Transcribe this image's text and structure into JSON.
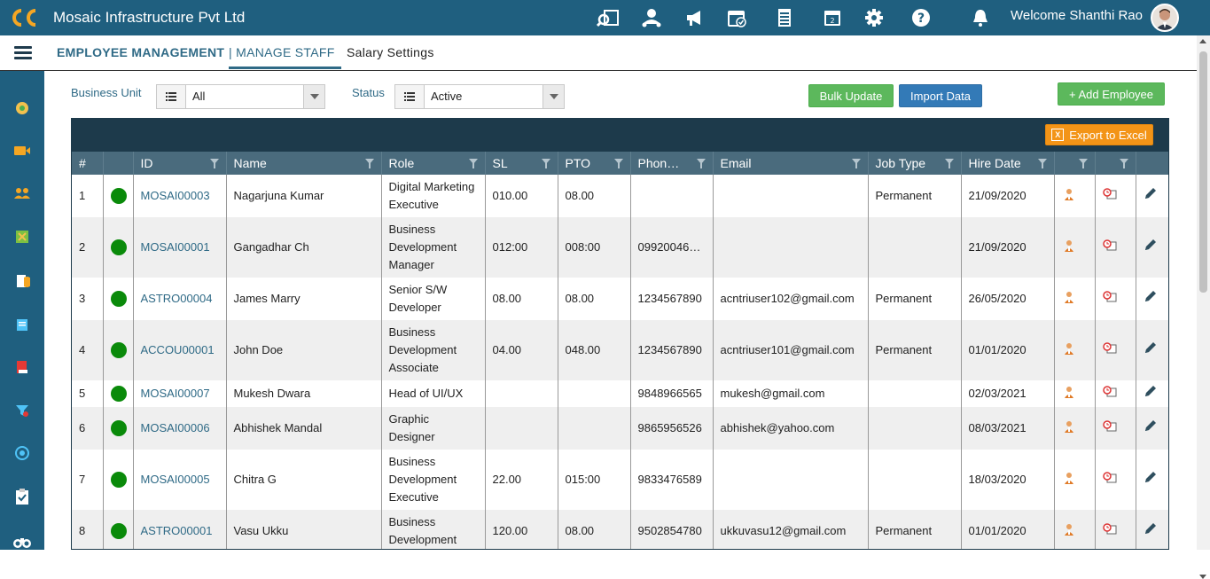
{
  "app": {
    "title": "Mosaic Infrastructure Pvt Ltd",
    "welcome": "Welcome Shanthi Rao"
  },
  "top_icons": [
    "search-report-icon",
    "team-icon",
    "announcement-icon",
    "calendar-check-icon",
    "document-list-icon",
    "calendar-day-icon",
    "gear-icon",
    "help-icon",
    "bell-icon"
  ],
  "nav": {
    "title": "EMPLOYEE MANAGEMENT",
    "active_tab": "| MANAGE STAFF",
    "tab": "Salary Settings"
  },
  "sidebar": [
    "dashboard-icon",
    "video-icon",
    "people-icon",
    "puzzle-icon",
    "pie-chart-icon",
    "notes-icon",
    "book-icon",
    "filter-icon",
    "target-icon",
    "clipboard-icon",
    "binoculars-icon"
  ],
  "filters": {
    "business_unit_label": "Business Unit",
    "business_unit_value": "All",
    "status_label": "Status",
    "status_value": "Active"
  },
  "actions": {
    "bulk_update": "Bulk Update",
    "import_data": "Import Data",
    "add_employee": "+ Add Employee",
    "export_excel": "Export to Excel"
  },
  "colors": {
    "brand": "#1f5f7f",
    "active_dot": "#0a8a0a",
    "export": "#f39417"
  },
  "table": {
    "headers": [
      "#",
      "",
      "ID",
      "Name",
      "Role",
      "SL",
      "PTO",
      "Phon…",
      "Email",
      "Job Type",
      "Hire Date",
      "",
      "",
      ""
    ],
    "rows": [
      {
        "num": "1",
        "id": "MOSAI00003",
        "name": "Nagarjuna Kumar",
        "role": [
          "Digital Marketing",
          "Executive"
        ],
        "sl": "010.00",
        "pto": "08.00",
        "phone": "",
        "email": "",
        "job_type": "Permanent",
        "hire_date": "21/09/2020"
      },
      {
        "num": "2",
        "id": "MOSAI00001",
        "name": "Gangadhar Ch",
        "role": [
          "Business",
          "Development",
          "Manager"
        ],
        "sl": "012:00",
        "pto": "008:00",
        "phone": "09920046…",
        "email": "",
        "job_type": "",
        "hire_date": "21/09/2020"
      },
      {
        "num": "3",
        "id": "ASTRO00004",
        "name": "James Marry",
        "role": [
          "Senior S/W",
          "Developer"
        ],
        "sl": "08.00",
        "pto": "08.00",
        "phone": "1234567890",
        "email": "acntriuser102@gmail.com",
        "job_type": "Permanent",
        "hire_date": "26/05/2020"
      },
      {
        "num": "4",
        "id": "ACCOU00001",
        "name": "John Doe",
        "role": [
          "Business",
          "Development",
          "Associate"
        ],
        "sl": "04.00",
        "pto": "048.00",
        "phone": "1234567890",
        "email": "acntriuser101@gmail.com",
        "job_type": "Permanent",
        "hire_date": "01/01/2020"
      },
      {
        "num": "5",
        "id": "MOSAI00007",
        "name": "Mukesh Dwara",
        "role": [
          "Head of UI/UX"
        ],
        "sl": "",
        "pto": "",
        "phone": "9848966565",
        "email": "mukesh@gmail.com",
        "job_type": "",
        "hire_date": "02/03/2021"
      },
      {
        "num": "6",
        "id": "MOSAI00006",
        "name": "Abhishek Mandal",
        "role": [
          "Graphic",
          "Designer"
        ],
        "sl": "",
        "pto": "",
        "phone": "9865956526",
        "email": "abhishek@yahoo.com",
        "job_type": "",
        "hire_date": "08/03/2021"
      },
      {
        "num": "7",
        "id": "MOSAI00005",
        "name": "Chitra G",
        "role": [
          "Business",
          "Development",
          "Executive"
        ],
        "sl": "22.00",
        "pto": "015:00",
        "phone": "9833476589",
        "email": "",
        "job_type": "",
        "hire_date": "18/03/2020"
      },
      {
        "num": "8",
        "id": "ASTRO00001",
        "name": "Vasu Ukku",
        "role": [
          "Business",
          "Development"
        ],
        "sl": "120.00",
        "pto": "08.00",
        "phone": "9502854780",
        "email": "ukkuvasu12@gmail.com",
        "job_type": "Permanent",
        "hire_date": "01/01/2020"
      }
    ]
  }
}
